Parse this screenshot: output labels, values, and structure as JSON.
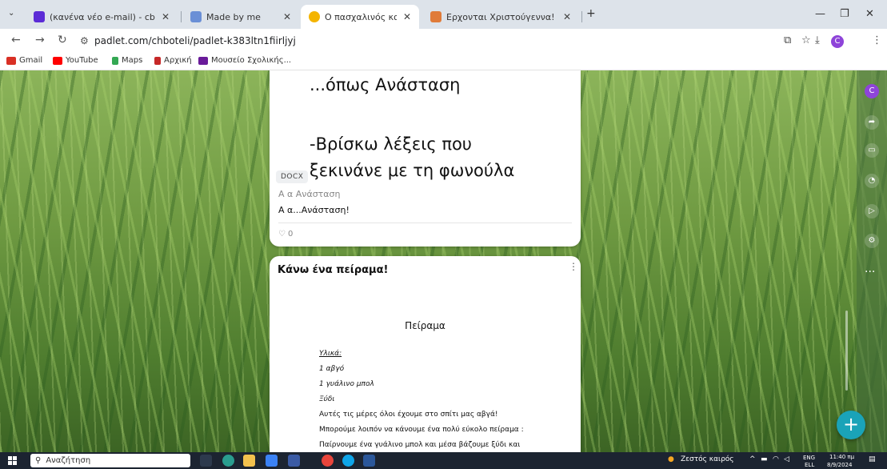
{
  "tabs": [
    {
      "label": "(κανένα νέο e-mail) - cbnip@y",
      "active": false
    },
    {
      "label": "Made by me",
      "active": false
    },
    {
      "label": "Ο πασχαλινός καμβάς μου",
      "active": true
    },
    {
      "label": "Ερχονται Χριστούγεννα!",
      "active": false
    }
  ],
  "address": {
    "url": "padlet.com/chboteli/padlet-k383ltn1fiirljyj"
  },
  "profile_initial": "C",
  "bookmarks": [
    "Gmail",
    "YouTube",
    "Maps",
    "Αρχική",
    "Μουσείο Σχολικής..."
  ],
  "card1": {
    "line1": "...όπως Ανάσταση",
    "line2": "-Βρίσκω λέξεις που",
    "line3": "ξεκινάνε με τη φωνούλα",
    "badge": "DOCX",
    "attachment_name": "Α α Ανάσταση",
    "attachment_text": "Α α...Ανάσταση!",
    "likes": "0"
  },
  "card2": {
    "title": "Κάνω ένα πείραμα!",
    "doc_heading": "Πείραμα",
    "materials_label": "Υλικά:",
    "materials": [
      "1 αβγό",
      "1 γυάλινο μπολ",
      "Ξύδι"
    ],
    "paragraphs": [
      "Αυτές τις μέρες όλοι έχουμε στο σπίτι μας αβγά!",
      "Μπορούμε λοιπόν να κάνουμε ένα πολύ εύκολο πείραμα :",
      "Παίρνουμε ένα γυάλινο μπολ και μέσα βάζουμε ξύδι και"
    ]
  },
  "sidebar": {
    "avatar": "C",
    "more": "..."
  },
  "fab": "+",
  "taskbar": {
    "search_placeholder": "Αναζήτηση",
    "weather": "Ζεστός καιρός",
    "lang": "ENG",
    "lang2": "ELL",
    "time": "11:40 πμ",
    "date": "8/9/2024"
  },
  "colors": {
    "accent": "#1aa3b8",
    "avatar": "#8e44d9",
    "taskbar": "#1c2431"
  }
}
